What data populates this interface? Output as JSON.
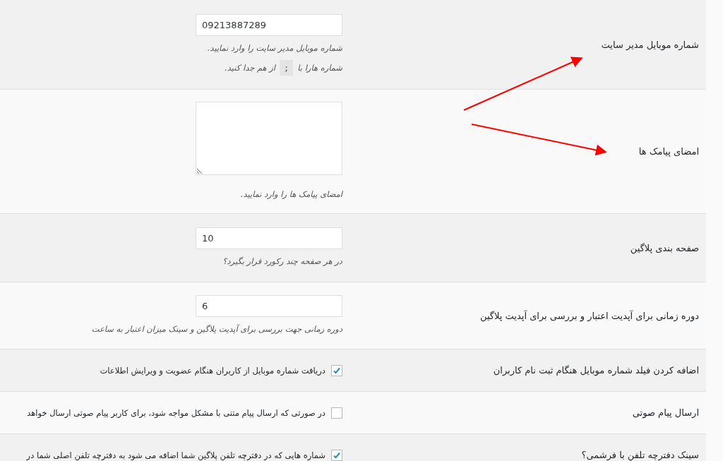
{
  "rows": [
    {
      "kind": "text",
      "label": "شماره موبایل مدیر سایت",
      "value": "09213887289",
      "hints": [
        [
          {
            "kind": "text",
            "text": "شماره موبایل مدیر سایت را وارد نمایید."
          }
        ],
        [
          {
            "kind": "text",
            "text": "شماره هارا با"
          },
          {
            "kind": "code",
            "text": ";"
          },
          {
            "kind": "text",
            "text": "از هم جدا کنید."
          }
        ]
      ]
    },
    {
      "kind": "textarea",
      "label": "امضای پیامک ها",
      "hints": [
        [
          {
            "kind": "text",
            "text": "امضای پیامک ها را وارد نمایید."
          }
        ]
      ]
    },
    {
      "kind": "text",
      "label": "صفحه بندی پلاگین",
      "value": "10",
      "hints": [
        [
          {
            "kind": "text",
            "text": "در هر صفحه چند رکورد قرار بگیرد؟"
          }
        ]
      ]
    },
    {
      "kind": "text",
      "label": "دوره زمانی برای آپدیت اعتبار و بررسی برای آپدیت پلاگین",
      "value": "6",
      "hints": [
        [
          {
            "kind": "text",
            "text": "دوره زمانی جهت بررسی برای آپدیت پلاگین و سینک میزان اعتبار به ساعت"
          }
        ]
      ]
    },
    {
      "kind": "checkbox",
      "label": "اضافه کردن فیلد شماره موبایل هنگام ثبت نام کاربران",
      "checked": true,
      "description": "دریافت شماره موبایل از کاربران هنگام عضویت و ویرایش اطلاعات"
    },
    {
      "kind": "checkbox",
      "label": "ارسال پیام صوتی",
      "checked": false,
      "description": "در صورتی که ارسال پیام متنی با مشکل مواجه شود، برای کاربر پیام صوتی ارسال خواهد"
    },
    {
      "kind": "checkbox",
      "label": "سینک دفترچه تلفن با فرشمی؟",
      "checked": true,
      "description": "شماره هایی که در دفترچه تلفن پلاگین شما اضافه می شود به دفترچه تلفن اصلی شما در"
    }
  ]
}
